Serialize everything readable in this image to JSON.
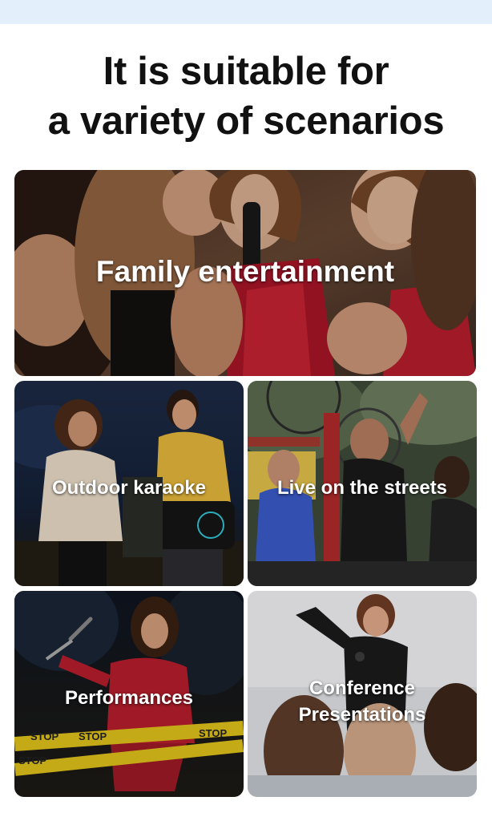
{
  "headline": {
    "line1": "It is suitable for",
    "line2": "a variety of scenarios"
  },
  "scenarios": [
    {
      "label": "Family entertainment"
    },
    {
      "label": "Outdoor karaoke"
    },
    {
      "label": "Live on the streets"
    },
    {
      "label": "Performances"
    },
    {
      "label_line1": "Conference",
      "label_line2": "Presentations"
    }
  ],
  "signs": {
    "stop": "STOP"
  }
}
